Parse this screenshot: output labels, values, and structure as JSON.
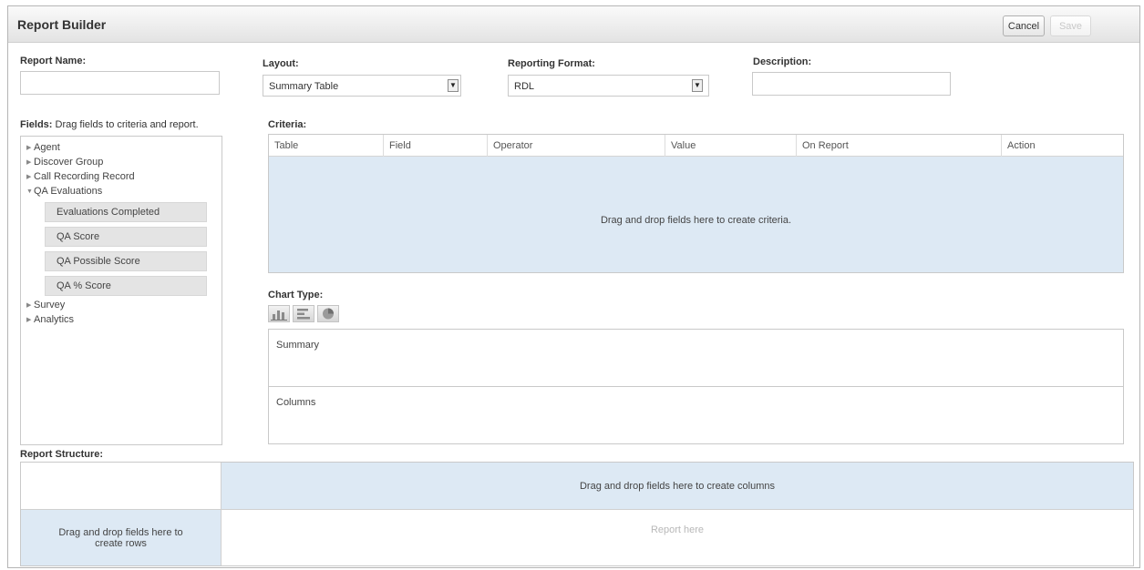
{
  "header": {
    "title": "Report Builder",
    "cancel_label": "Cancel",
    "save_label": "Save"
  },
  "form": {
    "report_name_label": "Report Name:",
    "report_name_value": "",
    "layout_label": "Layout:",
    "layout_value": "Summary Table",
    "format_label": "Reporting Format:",
    "format_value": "RDL",
    "description_label": "Description:",
    "description_value": ""
  },
  "fields": {
    "label": "Fields:",
    "hint": "Drag fields to criteria and report.",
    "tree": [
      {
        "label": "Agent",
        "expanded": false
      },
      {
        "label": "Discover Group",
        "expanded": false
      },
      {
        "label": "Call Recording Record",
        "expanded": false
      },
      {
        "label": "QA Evaluations",
        "expanded": true
      },
      {
        "label": "Survey",
        "expanded": false
      },
      {
        "label": "Analytics",
        "expanded": false
      }
    ],
    "qa_children": [
      "Evaluations Completed",
      "QA Score",
      "QA Possible Score",
      "QA % Score"
    ]
  },
  "criteria": {
    "label": "Criteria:",
    "columns": [
      "Table",
      "Field",
      "Operator",
      "Value",
      "On Report",
      "Action"
    ],
    "empty_message": "Drag and drop fields here to create criteria."
  },
  "chart": {
    "label": "Chart Type:",
    "icons": [
      "bar-chart-icon",
      "horizontal-bar-chart-icon",
      "pie-chart-icon"
    ]
  },
  "panels": {
    "summary_label": "Summary",
    "columns_label": "Columns"
  },
  "report_structure": {
    "label": "Report Structure:",
    "columns_message": "Drag and drop fields here to create columns",
    "rows_message": "Drag and drop fields here to create rows",
    "report_placeholder": "Report here"
  },
  "colors": {
    "drop_zone": "#dde9f4",
    "header_gradient_top": "#fafafa",
    "header_gradient_bottom": "#e3e3e3"
  }
}
